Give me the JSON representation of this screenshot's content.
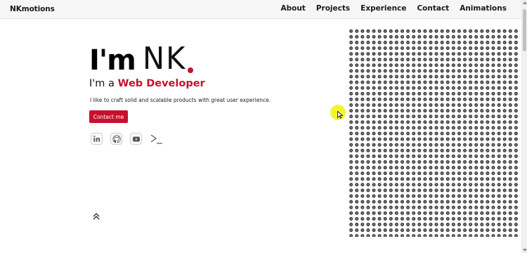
{
  "navbar": {
    "brand": "NKmotions",
    "links": [
      "About",
      "Projects",
      "Experience",
      "Contact",
      "Animations"
    ]
  },
  "hero": {
    "prefix": "I'm",
    "initials": "NK",
    "subtitle_prefix": "I'm a ",
    "subtitle_highlight": "Web Developer",
    "tagline": "I like to craft solid and scalable products with great user experience.",
    "contact_label": "Contact me"
  },
  "socials": {
    "icons": [
      "linkedin-icon",
      "github-icon",
      "youtube-icon",
      "terminal-icon"
    ]
  },
  "colors": {
    "accent": "#c8102e",
    "text": "#111111",
    "navbar_bg": "#f6f6f6",
    "cursor_highlight": "#f2f21a"
  }
}
